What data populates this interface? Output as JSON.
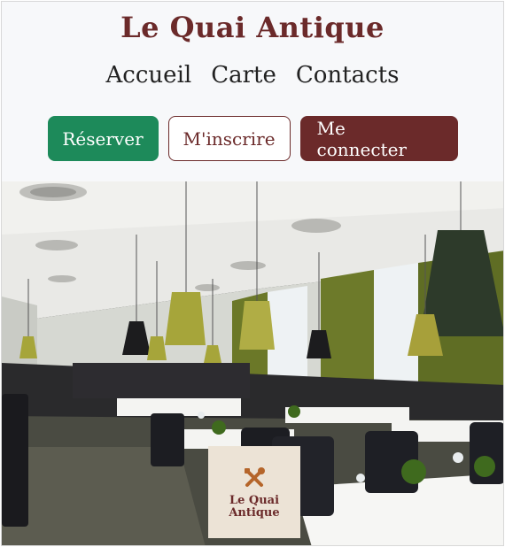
{
  "header": {
    "brand": "Le Quai Antique"
  },
  "nav": {
    "items": [
      {
        "label": "Accueil"
      },
      {
        "label": "Carte"
      },
      {
        "label": "Contacts"
      }
    ]
  },
  "actions": {
    "reserve_label": "Réserver",
    "signup_label": "M'inscrire",
    "login_label": "Me connecter"
  },
  "hero": {
    "logo_line1": "Le Quai",
    "logo_line2": "Antique",
    "logo_icon": "utensils-icon"
  },
  "colors": {
    "brand": "#6b2a2a",
    "reserve": "#1d8a5a",
    "background": "#f7f8fa"
  }
}
